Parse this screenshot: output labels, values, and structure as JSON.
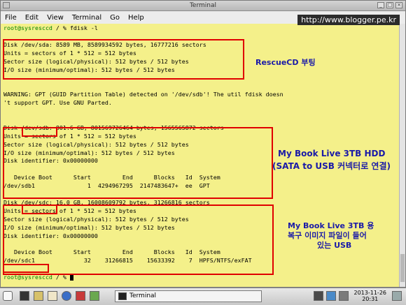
{
  "window": {
    "title": "Terminal"
  },
  "menu": [
    {
      "label": "File",
      "key": "F"
    },
    {
      "label": "Edit",
      "key": "E"
    },
    {
      "label": "View",
      "key": "V"
    },
    {
      "label": "Terminal",
      "key": "T"
    },
    {
      "label": "Go",
      "key": "G"
    },
    {
      "label": "Help",
      "key": "H"
    }
  ],
  "watermark": "http://www.blogger.pe.kr",
  "terminal": {
    "lines": [
      "root@sysresccd / % fdisk -l",
      "",
      "Disk /dev/sda: 8589 MB, 8589934592 bytes, 16777216 sectors",
      "Units = sectors of 1 * 512 = 512 bytes",
      "Sector size (logical/physical): 512 bytes / 512 bytes",
      "I/O size (minimum/optimal): 512 bytes / 512 bytes",
      "",
      "",
      "WARNING: GPT (GUID Partition Table) detected on '/dev/sdb'! The util fdisk doesn",
      "'t support GPT. Use GNU Parted.",
      "",
      "",
      "Disk /dev/sdb: 801.6 GB, 801569726464 bytes, 1565565872 sectors",
      "Units = sectors of 1 * 512 = 512 bytes",
      "Sector size (logical/physical): 512 bytes / 512 bytes",
      "I/O size (minimum/optimal): 512 bytes / 512 bytes",
      "Disk identifier: 0x00000000",
      "",
      "   Device Boot      Start         End      Blocks   Id  System",
      "/dev/sdb1               1  4294967295  2147483647+  ee  GPT",
      "",
      "Disk /dev/sdc: 16.0 GB, 16008609792 bytes, 31266816 sectors",
      "Units = sectors of 1 * 512 = 512 bytes",
      "Sector size (logical/physical): 512 bytes / 512 bytes",
      "I/O size (minimum/optimal): 512 bytes / 512 bytes",
      "Disk identifier: 0x00000000",
      "",
      "   Device Boot      Start         End      Blocks   Id  System",
      "/dev/sdc1              32    31266815    15633392    7  HPFS/NTFS/exFAT",
      "",
      "root@sysresccd / % "
    ]
  },
  "annotations": {
    "sda": "RescueCD 부팅",
    "sdb_line1": "My Book Live 3TB HDD",
    "sdb_line2": "(SATA to USB 커넥터로 연결)",
    "sdc_line1": "My Book Live 3TB 용",
    "sdc_line2": "복구 이미지 파일이 들어",
    "sdc_line3": "있는 USB"
  },
  "taskbar": {
    "task_label": "Terminal",
    "date": "2013-11-26",
    "time": "20:31"
  },
  "colors": {
    "terminal_bg": "#f4f08a",
    "prompt": "#008000",
    "highlight_box": "#e00000",
    "annotation": "#1a1aa8"
  }
}
